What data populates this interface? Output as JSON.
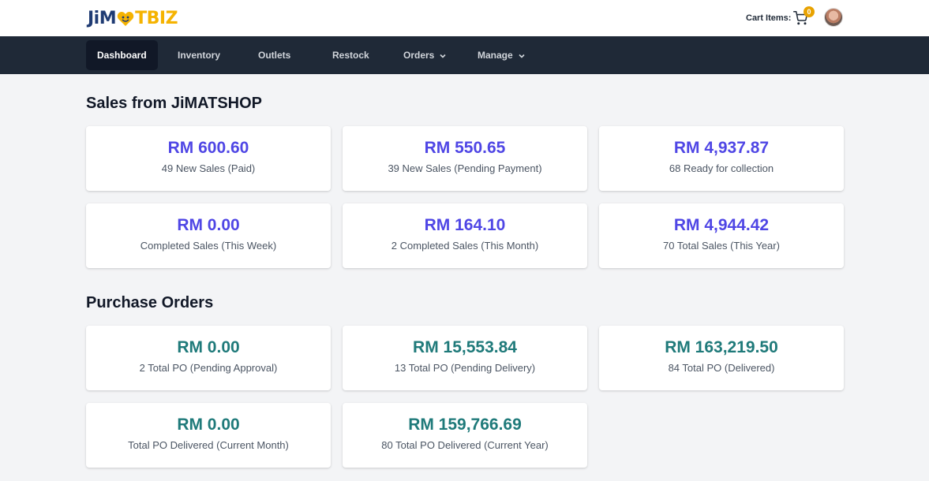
{
  "brand": {
    "logo_left": "JiM",
    "logo_right": "TBIZ"
  },
  "header": {
    "cart_label": "Cart Items:",
    "cart_count": "0"
  },
  "nav": {
    "items": [
      {
        "label": "Dashboard"
      },
      {
        "label": "Inventory"
      },
      {
        "label": "Outlets"
      },
      {
        "label": "Restock"
      },
      {
        "label": "Orders"
      },
      {
        "label": "Manage"
      }
    ]
  },
  "sales": {
    "title": "Sales from JiMATSHOP",
    "cards": [
      {
        "value": "RM 600.60",
        "label": "49 New Sales (Paid)"
      },
      {
        "value": "RM 550.65",
        "label": "39 New Sales (Pending Payment)"
      },
      {
        "value": "RM 4,937.87",
        "label": "68 Ready for collection"
      },
      {
        "value": "RM 0.00",
        "label": "Completed Sales (This Week)"
      },
      {
        "value": "RM 164.10",
        "label": "2 Completed Sales (This Month)"
      },
      {
        "value": "RM 4,944.42",
        "label": "70 Total Sales (This Year)"
      }
    ]
  },
  "purchase_orders": {
    "title": "Purchase Orders",
    "cards": [
      {
        "value": "RM 0.00",
        "label": "2 Total PO (Pending Approval)"
      },
      {
        "value": "RM 15,553.84",
        "label": "13 Total PO (Pending Delivery)"
      },
      {
        "value": "RM 163,219.50",
        "label": "84 Total PO (Delivered)"
      },
      {
        "value": "RM 0.00",
        "label": "Total PO Delivered (Current Month)"
      },
      {
        "value": "RM 159,766.69",
        "label": "80 Total PO Delivered (Current Year)"
      }
    ]
  },
  "colors": {
    "nav_bg": "#1f2937",
    "sales_value": "#4f46e5",
    "po_value": "#1f7a7a",
    "badge": "#e8a200",
    "logo_blue": "#1f3b73",
    "logo_yellow": "#f5b301"
  }
}
